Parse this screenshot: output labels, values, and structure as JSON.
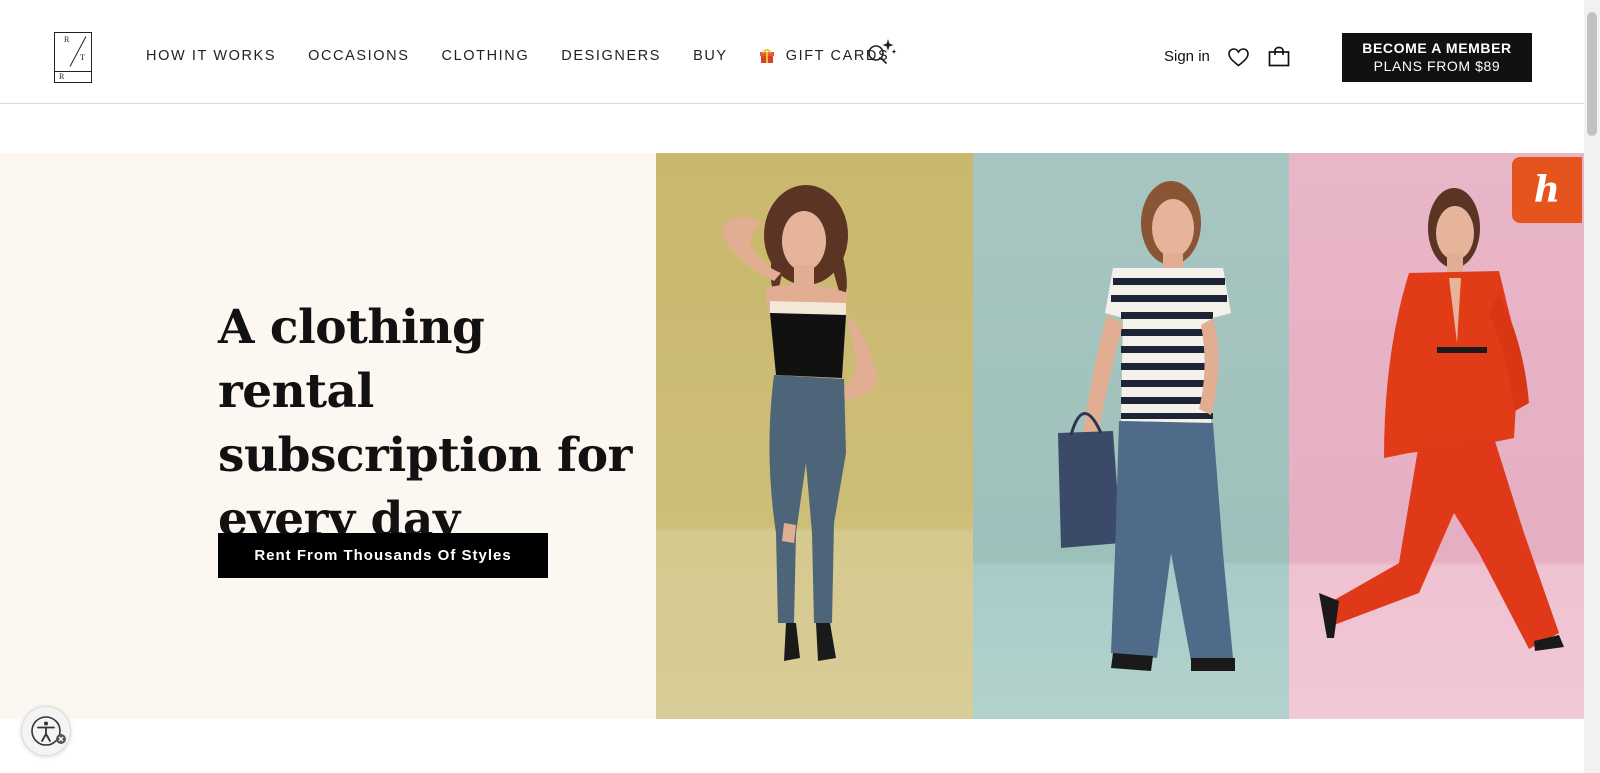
{
  "header": {
    "logo_letters": [
      "R",
      "T",
      "R"
    ],
    "nav": [
      {
        "label": "HOW IT WORKS"
      },
      {
        "label": "OCCASIONS"
      },
      {
        "label": "CLOTHING"
      },
      {
        "label": "DESIGNERS"
      },
      {
        "label": "BUY"
      },
      {
        "label": "GIFT CARDS",
        "icon": "gift-icon"
      }
    ],
    "search_icon": "ai-sparkle-search-icon",
    "signin_label": "Sign in",
    "heart_icon": "heart-icon",
    "bag_icon": "bag-icon",
    "member_button": {
      "line1": "BECOME A MEMBER",
      "line2": "PLANS FROM $89"
    }
  },
  "hero": {
    "title": "A clothing rental subscription for every day",
    "cta_label": "Rent From Thousands Of Styles",
    "background_color": "#fdf7f2",
    "panels": [
      {
        "name": "model-black-top-jeans",
        "background": "#c9b86c"
      },
      {
        "name": "model-striped-polo-jeans",
        "background": "#a8c6c1"
      },
      {
        "name": "model-red-suit",
        "background": "#e9b6c8"
      }
    ]
  },
  "widgets": {
    "honey_label": "h",
    "honey_color": "#e4541c",
    "accessibility_icon": "accessibility-icon"
  }
}
